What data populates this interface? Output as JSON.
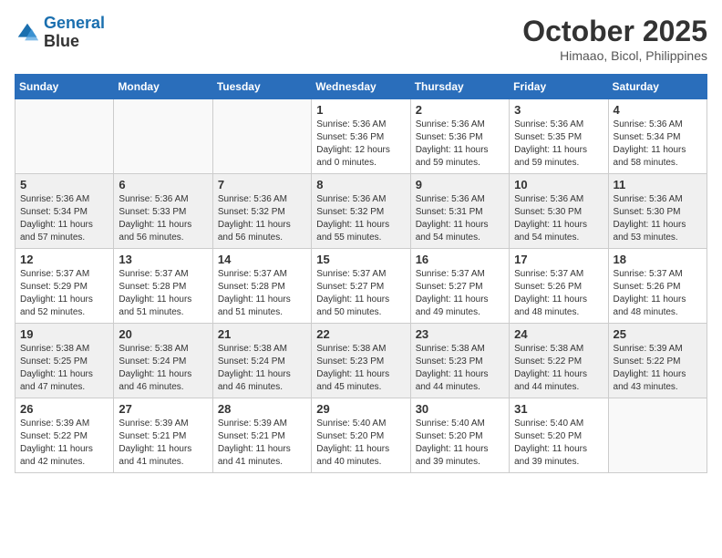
{
  "header": {
    "logo_line1": "General",
    "logo_line2": "Blue",
    "month": "October 2025",
    "location": "Himaao, Bicol, Philippines"
  },
  "weekdays": [
    "Sunday",
    "Monday",
    "Tuesday",
    "Wednesday",
    "Thursday",
    "Friday",
    "Saturday"
  ],
  "weeks": [
    {
      "shaded": false,
      "days": [
        {
          "num": "",
          "info": ""
        },
        {
          "num": "",
          "info": ""
        },
        {
          "num": "",
          "info": ""
        },
        {
          "num": "1",
          "info": "Sunrise: 5:36 AM\nSunset: 5:36 PM\nDaylight: 12 hours\nand 0 minutes."
        },
        {
          "num": "2",
          "info": "Sunrise: 5:36 AM\nSunset: 5:36 PM\nDaylight: 11 hours\nand 59 minutes."
        },
        {
          "num": "3",
          "info": "Sunrise: 5:36 AM\nSunset: 5:35 PM\nDaylight: 11 hours\nand 59 minutes."
        },
        {
          "num": "4",
          "info": "Sunrise: 5:36 AM\nSunset: 5:34 PM\nDaylight: 11 hours\nand 58 minutes."
        }
      ]
    },
    {
      "shaded": true,
      "days": [
        {
          "num": "5",
          "info": "Sunrise: 5:36 AM\nSunset: 5:34 PM\nDaylight: 11 hours\nand 57 minutes."
        },
        {
          "num": "6",
          "info": "Sunrise: 5:36 AM\nSunset: 5:33 PM\nDaylight: 11 hours\nand 56 minutes."
        },
        {
          "num": "7",
          "info": "Sunrise: 5:36 AM\nSunset: 5:32 PM\nDaylight: 11 hours\nand 56 minutes."
        },
        {
          "num": "8",
          "info": "Sunrise: 5:36 AM\nSunset: 5:32 PM\nDaylight: 11 hours\nand 55 minutes."
        },
        {
          "num": "9",
          "info": "Sunrise: 5:36 AM\nSunset: 5:31 PM\nDaylight: 11 hours\nand 54 minutes."
        },
        {
          "num": "10",
          "info": "Sunrise: 5:36 AM\nSunset: 5:30 PM\nDaylight: 11 hours\nand 54 minutes."
        },
        {
          "num": "11",
          "info": "Sunrise: 5:36 AM\nSunset: 5:30 PM\nDaylight: 11 hours\nand 53 minutes."
        }
      ]
    },
    {
      "shaded": false,
      "days": [
        {
          "num": "12",
          "info": "Sunrise: 5:37 AM\nSunset: 5:29 PM\nDaylight: 11 hours\nand 52 minutes."
        },
        {
          "num": "13",
          "info": "Sunrise: 5:37 AM\nSunset: 5:28 PM\nDaylight: 11 hours\nand 51 minutes."
        },
        {
          "num": "14",
          "info": "Sunrise: 5:37 AM\nSunset: 5:28 PM\nDaylight: 11 hours\nand 51 minutes."
        },
        {
          "num": "15",
          "info": "Sunrise: 5:37 AM\nSunset: 5:27 PM\nDaylight: 11 hours\nand 50 minutes."
        },
        {
          "num": "16",
          "info": "Sunrise: 5:37 AM\nSunset: 5:27 PM\nDaylight: 11 hours\nand 49 minutes."
        },
        {
          "num": "17",
          "info": "Sunrise: 5:37 AM\nSunset: 5:26 PM\nDaylight: 11 hours\nand 48 minutes."
        },
        {
          "num": "18",
          "info": "Sunrise: 5:37 AM\nSunset: 5:26 PM\nDaylight: 11 hours\nand 48 minutes."
        }
      ]
    },
    {
      "shaded": true,
      "days": [
        {
          "num": "19",
          "info": "Sunrise: 5:38 AM\nSunset: 5:25 PM\nDaylight: 11 hours\nand 47 minutes."
        },
        {
          "num": "20",
          "info": "Sunrise: 5:38 AM\nSunset: 5:24 PM\nDaylight: 11 hours\nand 46 minutes."
        },
        {
          "num": "21",
          "info": "Sunrise: 5:38 AM\nSunset: 5:24 PM\nDaylight: 11 hours\nand 46 minutes."
        },
        {
          "num": "22",
          "info": "Sunrise: 5:38 AM\nSunset: 5:23 PM\nDaylight: 11 hours\nand 45 minutes."
        },
        {
          "num": "23",
          "info": "Sunrise: 5:38 AM\nSunset: 5:23 PM\nDaylight: 11 hours\nand 44 minutes."
        },
        {
          "num": "24",
          "info": "Sunrise: 5:38 AM\nSunset: 5:22 PM\nDaylight: 11 hours\nand 44 minutes."
        },
        {
          "num": "25",
          "info": "Sunrise: 5:39 AM\nSunset: 5:22 PM\nDaylight: 11 hours\nand 43 minutes."
        }
      ]
    },
    {
      "shaded": false,
      "days": [
        {
          "num": "26",
          "info": "Sunrise: 5:39 AM\nSunset: 5:22 PM\nDaylight: 11 hours\nand 42 minutes."
        },
        {
          "num": "27",
          "info": "Sunrise: 5:39 AM\nSunset: 5:21 PM\nDaylight: 11 hours\nand 41 minutes."
        },
        {
          "num": "28",
          "info": "Sunrise: 5:39 AM\nSunset: 5:21 PM\nDaylight: 11 hours\nand 41 minutes."
        },
        {
          "num": "29",
          "info": "Sunrise: 5:40 AM\nSunset: 5:20 PM\nDaylight: 11 hours\nand 40 minutes."
        },
        {
          "num": "30",
          "info": "Sunrise: 5:40 AM\nSunset: 5:20 PM\nDaylight: 11 hours\nand 39 minutes."
        },
        {
          "num": "31",
          "info": "Sunrise: 5:40 AM\nSunset: 5:20 PM\nDaylight: 11 hours\nand 39 minutes."
        },
        {
          "num": "",
          "info": ""
        }
      ]
    }
  ]
}
